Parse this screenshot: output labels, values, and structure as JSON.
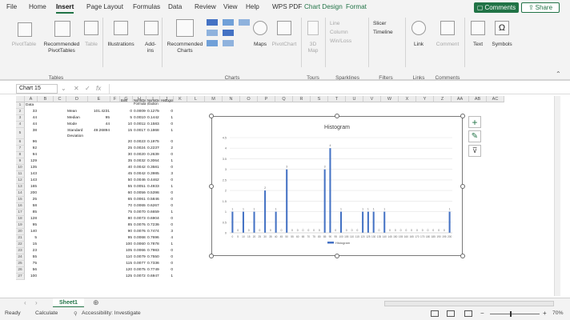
{
  "menu": {
    "tabs": [
      "File",
      "Home",
      "Insert",
      "Page Layout",
      "Formulas",
      "Data",
      "Review",
      "View",
      "Help",
      "WPS PDF",
      "Chart Design",
      "Format"
    ],
    "active": "Insert",
    "comments": "Comments",
    "share": "Share"
  },
  "ribbon": {
    "groups": {
      "tables": "Tables",
      "charts": "Charts",
      "tours": "Tours",
      "sparklines": "Sparklines",
      "filters": "Filters",
      "links": "Links",
      "comments": "Comments"
    },
    "items": {
      "pivot_table": "PivotTable",
      "recommended_pivot": "Recommended\nPivotTables",
      "table": "Table",
      "illustrations": "Illustrations",
      "addins": "Add-\nins",
      "recommended_charts": "Recommended\nCharts",
      "maps": "Maps",
      "pivot_chart": "PivotChart",
      "map3d": "3D\nMap",
      "spark_line": "Line",
      "spark_column": "Column",
      "spark_winloss": "Win/Loss",
      "slicer": "Slicer",
      "timeline": "Timeline",
      "link": "Link",
      "comment": "Comment",
      "text": "Text",
      "symbols": "Symbols"
    }
  },
  "formula_bar": {
    "name_box": "Chart 15",
    "fx": "fx"
  },
  "columns": [
    "A",
    "B",
    "C",
    "D",
    "E",
    "F",
    "G",
    "H",
    "I",
    "J",
    "K",
    "L",
    "M",
    "N",
    "O",
    "P",
    "Q",
    "R",
    "S",
    "T",
    "U",
    "V",
    "W",
    "X",
    "Y",
    "Z",
    "AA",
    "AB",
    "AC"
  ],
  "rows": [
    "1",
    "2",
    "3",
    "4",
    "5",
    "6",
    "7",
    "8",
    "9",
    "10",
    "11",
    "12",
    "13",
    "14",
    "15",
    "16",
    "17",
    "18",
    "19",
    "20",
    "21",
    "22",
    "23",
    "24",
    "25",
    "26",
    "27"
  ],
  "data_col_a": {
    "header": "Data",
    "values": [
      "33",
      "44",
      "44",
      "38",
      "96",
      "92",
      "94",
      "129",
      "135",
      "143",
      "143",
      "165",
      "200",
      "25",
      "58",
      "85",
      "128",
      "95",
      "140",
      "5",
      "15",
      "23",
      "55",
      "75",
      "56",
      "100"
    ]
  },
  "stats": [
    {
      "label": "Mean",
      "value": "101.4231"
    },
    {
      "label": "Median",
      "value": "95"
    },
    {
      "label": "Mode",
      "value": "44"
    },
    {
      "label": "Standard Deviation",
      "value": "49.26894"
    }
  ],
  "table_g_j": {
    "headers": [
      "Bins",
      "NormDist Formula",
      "NormDist ribution in",
      "Histogram"
    ],
    "rows": [
      [
        "0",
        "0.000968",
        "0.127504",
        "0"
      ],
      [
        "5",
        "0.001084",
        "0.14421",
        "1"
      ],
      [
        "10",
        "0.001185",
        "0.158349",
        "0"
      ],
      [
        "15",
        "0.001747",
        "0.18681",
        "1"
      ],
      [
        "20",
        "0.002375",
        "0.197572",
        "0"
      ],
      [
        "25",
        "0.00244",
        "0.223704",
        "2"
      ],
      [
        "30",
        "0.002059",
        "0.263916",
        "0"
      ],
      [
        "35",
        "0.00327",
        "0.30643",
        "1"
      ],
      [
        "40",
        "0.004289",
        "0.358133",
        "0"
      ],
      [
        "45",
        "0.004268",
        "0.398534",
        "3"
      ],
      [
        "50",
        "0.004666",
        "0.446293",
        "0"
      ],
      [
        "55",
        "0.005183",
        "0.493367",
        "1"
      ],
      [
        "60",
        "0.005603",
        "0.539846",
        "0"
      ],
      [
        "65",
        "0.00618",
        "0.58468",
        "0"
      ],
      [
        "70",
        "0.006598",
        "0.62678",
        "0"
      ],
      [
        "75",
        "0.007083",
        "0.665963",
        "1"
      ],
      [
        "80",
        "0.007352",
        "0.690404",
        "0"
      ],
      [
        "85",
        "0.007643",
        "0.723606",
        "0"
      ],
      [
        "90",
        "0.007684",
        "0.747424",
        "3"
      ],
      [
        "95",
        "0.00683",
        "0.769612",
        "4"
      ],
      [
        "100",
        "0.006074",
        "0.787853",
        "1"
      ],
      [
        "105",
        "0.006656",
        "0.798356",
        "0"
      ],
      [
        "110",
        "0.007957",
        "0.75508",
        "0"
      ],
      [
        "115",
        "0.007770",
        "0.733690",
        "0"
      ],
      [
        "120",
        "0.007525",
        "0.774953",
        "0"
      ],
      [
        "125",
        "0.007250",
        "0.694718",
        "1"
      ]
    ]
  },
  "chart_data": {
    "type": "bar",
    "title": "Histogram",
    "legend": "Histogram",
    "legend_position": "bottom",
    "ylim": [
      0,
      4.5
    ],
    "y_ticks": [
      "0",
      "0.5",
      "1",
      "1.5",
      "2",
      "2.5",
      "3",
      "3.5",
      "4",
      "4.5"
    ],
    "categories": [
      "0",
      "5",
      "10",
      "15",
      "20",
      "25",
      "30",
      "35",
      "40",
      "45",
      "50",
      "55",
      "60",
      "65",
      "70",
      "75",
      "80",
      "85",
      "90",
      "95",
      "100",
      "105",
      "110",
      "115",
      "120",
      "125",
      "130",
      "135",
      "140",
      "145",
      "150",
      "155",
      "160",
      "165",
      "170",
      "175",
      "180",
      "185",
      "190",
      "195",
      "200"
    ],
    "values": [
      1,
      0,
      1,
      0,
      1,
      0,
      2,
      0,
      1,
      0,
      3,
      0,
      0,
      0,
      0,
      0,
      0,
      3,
      4,
      0,
      1,
      0,
      0,
      0,
      1,
      1,
      1,
      0,
      1,
      0,
      0,
      0,
      0,
      0,
      0,
      0,
      0,
      0,
      0,
      0,
      1
    ],
    "grid": true
  },
  "sheet": {
    "name": "Sheet1"
  },
  "status": {
    "ready": "Ready",
    "calculate": "Calculate",
    "accessibility": "Accessibility: Investigate",
    "zoom": "70%"
  }
}
